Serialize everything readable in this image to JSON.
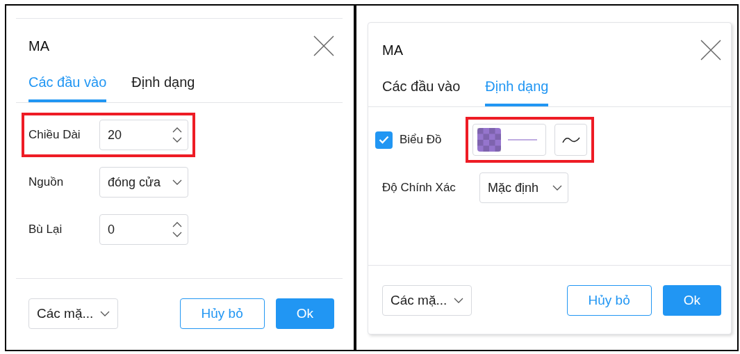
{
  "panels": [
    {
      "title": "MA",
      "tabs": [
        {
          "label": "Các đầu vào",
          "selected": true
        },
        {
          "label": "Định dạng",
          "selected": false
        }
      ],
      "rows": [
        {
          "kind": "number",
          "label": "Chiều Dài",
          "value": "20",
          "highlighted": true
        },
        {
          "kind": "select",
          "label": "Nguồn",
          "value": "đóng cửa",
          "highlighted": false
        },
        {
          "kind": "number",
          "label": "Bù Lại",
          "value": "0",
          "highlighted": false
        }
      ],
      "footer": {
        "defaults": "Các mặ...",
        "cancel": "Hủy bỏ",
        "ok": "Ok"
      }
    },
    {
      "title": "MA",
      "tabs": [
        {
          "label": "Các đầu vào",
          "selected": false
        },
        {
          "label": "Định dạng",
          "selected": true
        }
      ],
      "rows": [
        {
          "kind": "plot",
          "label": "Biểu Đồ",
          "checked": true,
          "color": "#9575cd",
          "highlighted": true
        },
        {
          "kind": "select",
          "label": "Độ Chính Xác",
          "value": "Mặc định",
          "highlighted": false
        }
      ],
      "footer": {
        "defaults": "Các mặ...",
        "cancel": "Hủy bỏ",
        "ok": "Ok"
      }
    }
  ]
}
